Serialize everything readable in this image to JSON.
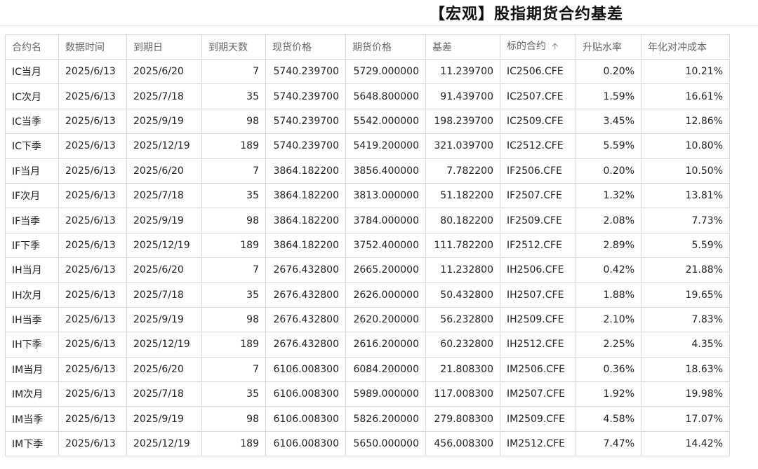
{
  "title": "【宏观】股指期货合约基差",
  "table": {
    "columns": [
      "合约名",
      "数据时间",
      "到期日",
      "到期天数",
      "现货价格",
      "期货价格",
      "基差",
      "标的合约",
      "升贴水率",
      "年化对冲成本"
    ],
    "sort_icon": "arrow-up-icon",
    "rows": [
      [
        "IC当月",
        "2025/6/13",
        "2025/6/20",
        "7",
        "5740.239700",
        "5729.000000",
        "11.239700",
        "IC2506.CFE",
        "0.20%",
        "10.21%"
      ],
      [
        "IC次月",
        "2025/6/13",
        "2025/7/18",
        "35",
        "5740.239700",
        "5648.800000",
        "91.439700",
        "IC2507.CFE",
        "1.59%",
        "16.61%"
      ],
      [
        "IC当季",
        "2025/6/13",
        "2025/9/19",
        "98",
        "5740.239700",
        "5542.000000",
        "198.239700",
        "IC2509.CFE",
        "3.45%",
        "12.86%"
      ],
      [
        "IC下季",
        "2025/6/13",
        "2025/12/19",
        "189",
        "5740.239700",
        "5419.200000",
        "321.039700",
        "IC2512.CFE",
        "5.59%",
        "10.80%"
      ],
      [
        "IF当月",
        "2025/6/13",
        "2025/6/20",
        "7",
        "3864.182200",
        "3856.400000",
        "7.782200",
        "IF2506.CFE",
        "0.20%",
        "10.50%"
      ],
      [
        "IF次月",
        "2025/6/13",
        "2025/7/18",
        "35",
        "3864.182200",
        "3813.000000",
        "51.182200",
        "IF2507.CFE",
        "1.32%",
        "13.81%"
      ],
      [
        "IF当季",
        "2025/6/13",
        "2025/9/19",
        "98",
        "3864.182200",
        "3784.000000",
        "80.182200",
        "IF2509.CFE",
        "2.08%",
        "7.73%"
      ],
      [
        "IF下季",
        "2025/6/13",
        "2025/12/19",
        "189",
        "3864.182200",
        "3752.400000",
        "111.782200",
        "IF2512.CFE",
        "2.89%",
        "5.59%"
      ],
      [
        "IH当月",
        "2025/6/13",
        "2025/6/20",
        "7",
        "2676.432800",
        "2665.200000",
        "11.232800",
        "IH2506.CFE",
        "0.42%",
        "21.88%"
      ],
      [
        "IH次月",
        "2025/6/13",
        "2025/7/18",
        "35",
        "2676.432800",
        "2626.000000",
        "50.432800",
        "IH2507.CFE",
        "1.88%",
        "19.65%"
      ],
      [
        "IH当季",
        "2025/6/13",
        "2025/9/19",
        "98",
        "2676.432800",
        "2620.200000",
        "56.232800",
        "IH2509.CFE",
        "2.10%",
        "7.83%"
      ],
      [
        "IH下季",
        "2025/6/13",
        "2025/12/19",
        "189",
        "2676.432800",
        "2616.200000",
        "60.232800",
        "IH2512.CFE",
        "2.25%",
        "4.35%"
      ],
      [
        "IM当月",
        "2025/6/13",
        "2025/6/20",
        "7",
        "6106.008300",
        "6084.200000",
        "21.808300",
        "IM2506.CFE",
        "0.36%",
        "18.63%"
      ],
      [
        "IM次月",
        "2025/6/13",
        "2025/7/18",
        "35",
        "6106.008300",
        "5989.000000",
        "117.008300",
        "IM2507.CFE",
        "1.92%",
        "19.98%"
      ],
      [
        "IM当季",
        "2025/6/13",
        "2025/9/19",
        "98",
        "6106.008300",
        "5826.200000",
        "279.808300",
        "IM2509.CFE",
        "4.58%",
        "17.07%"
      ],
      [
        "IM下季",
        "2025/6/13",
        "2025/12/19",
        "189",
        "6106.008300",
        "5650.000000",
        "456.008300",
        "IM2512.CFE",
        "7.47%",
        "14.42%"
      ]
    ]
  }
}
